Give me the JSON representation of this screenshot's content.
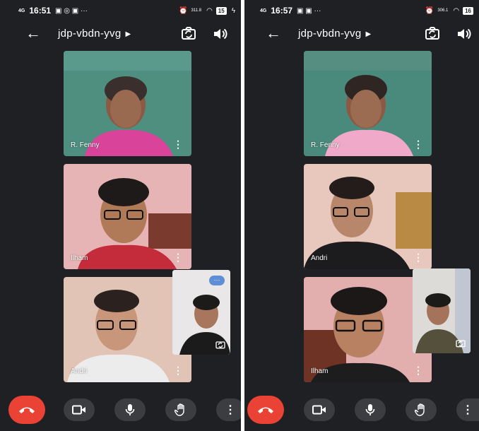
{
  "screens": [
    {
      "status": {
        "signal": "4G",
        "time": "16:51",
        "speed": "311.8",
        "battery": "15"
      },
      "meeting_code": "jdp-vbdn-yvg",
      "participants": [
        {
          "name": "R. Fenny"
        },
        {
          "name": "Ilham"
        },
        {
          "name": "Andri"
        }
      ]
    },
    {
      "status": {
        "signal": "4G",
        "time": "16:57",
        "speed": "306.1",
        "battery": "16"
      },
      "meeting_code": "jdp-vbdn-yvg",
      "participants": [
        {
          "name": "R. Fenny"
        },
        {
          "name": "Andri"
        },
        {
          "name": "Ilham"
        }
      ]
    }
  ],
  "icons": {
    "back": "arrow-left-icon",
    "switch_camera": "switch-camera-icon",
    "speaker": "speaker-icon",
    "end_call": "phone-end-icon",
    "camera": "video-camera-icon",
    "mic": "microphone-icon",
    "raise_hand": "hand-icon",
    "more": "more-vertical-icon"
  },
  "colors": {
    "end_call": "#ea4335",
    "background": "#1f2023",
    "control": "#3c3d41"
  }
}
